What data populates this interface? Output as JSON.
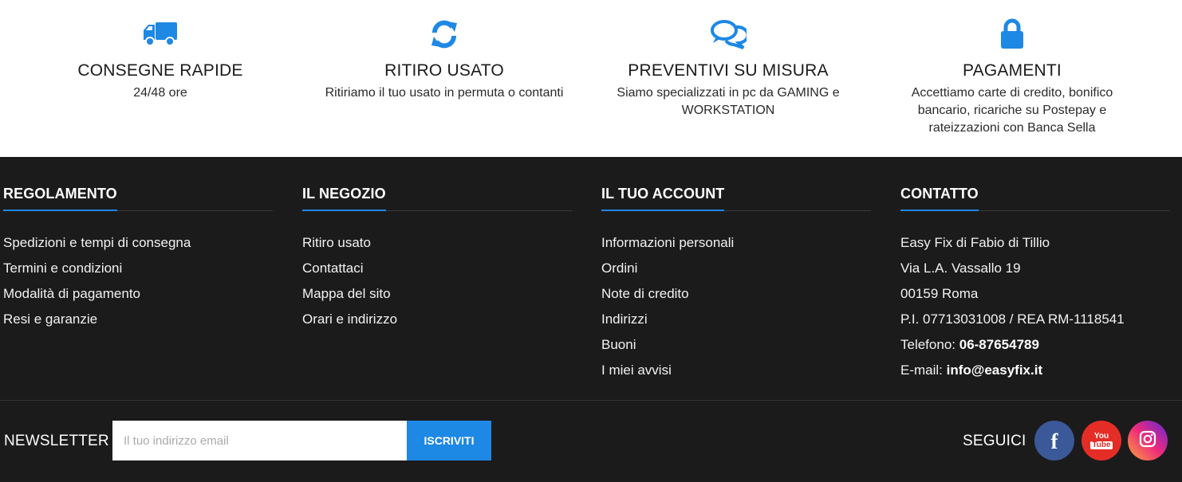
{
  "features": [
    {
      "icon": "truck-icon",
      "title": "CONSEGNE RAPIDE",
      "description": "24/48 ore"
    },
    {
      "icon": "refresh-icon",
      "title": "RITIRO USATO",
      "description": "Ritiriamo il tuo usato in permuta o contanti"
    },
    {
      "icon": "chat-bubbles-icon",
      "title": "PREVENTIVI SU MISURA",
      "description": "Siamo specializzati in pc da GAMING e WORKSTATION"
    },
    {
      "icon": "lock-icon",
      "title": "PAGAMENTI",
      "description": "Accettiamo carte di credito, bonifico bancario, ricariche su Postepay e rateizzazioni con Banca Sella"
    }
  ],
  "footer": {
    "regolamento": {
      "heading": "REGOLAMENTO",
      "links": [
        "Spedizioni e tempi di consegna",
        "Termini e condizioni",
        "Modalità di pagamento",
        "Resi e garanzie"
      ]
    },
    "negozio": {
      "heading": "IL NEGOZIO",
      "links": [
        "Ritiro usato",
        "Contattaci",
        "Mappa del sito",
        "Orari e indirizzo"
      ]
    },
    "account": {
      "heading": "IL TUO ACCOUNT",
      "links": [
        "Informazioni personali",
        "Ordini",
        "Note di credito",
        "Indirizzi",
        "Buoni",
        "I miei avvisi"
      ]
    },
    "contatto": {
      "heading": "CONTATTO",
      "company": "Easy Fix di Fabio di Tillio",
      "street": "Via L.A. Vassallo 19",
      "city": "00159 Roma",
      "vat": "P.I. 07713031008 / REA RM-1118541",
      "phone_label": "Telefono: ",
      "phone": "06-87654789",
      "email_label": "E-mail: ",
      "email": "info@easyfix.it"
    }
  },
  "newsletter": {
    "label": "NEWSLETTER",
    "placeholder": "Il tuo indirizzo email",
    "button": "ISCRIVITI"
  },
  "social": {
    "label": "SEGUICI",
    "facebook_glyph": "f",
    "youtube_top": "You",
    "youtube_bottom": "Tube",
    "icons": [
      "facebook-icon",
      "youtube-icon",
      "instagram-icon"
    ]
  },
  "colors": {
    "accent": "#1e88e5",
    "footer_bg": "#1c1b1c",
    "facebook": "#3b5998",
    "youtube": "#e52d27"
  }
}
